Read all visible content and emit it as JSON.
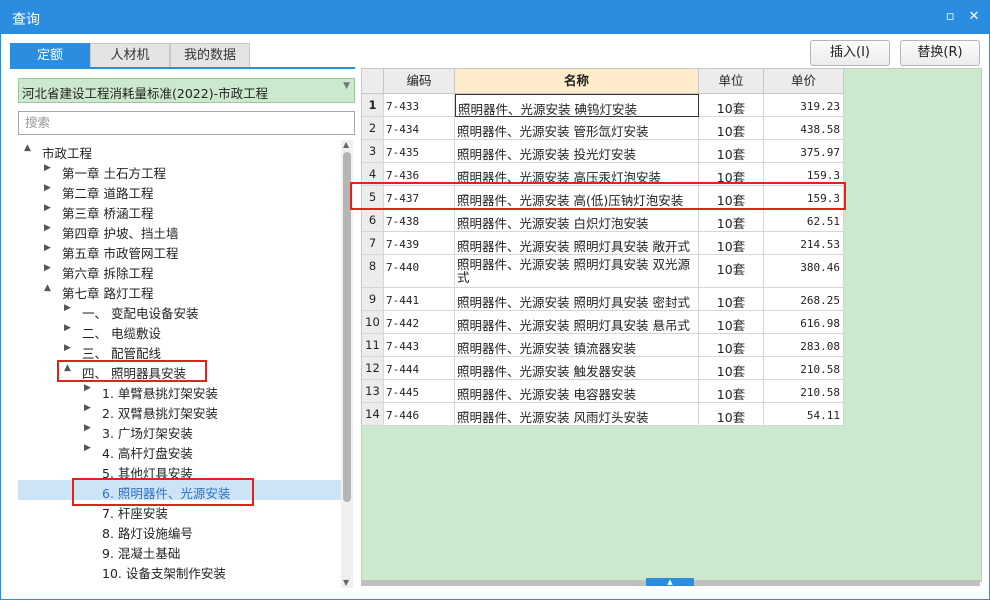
{
  "window": {
    "title": "查询",
    "maximize_icon": "maximize-icon",
    "close_icon": "close-icon"
  },
  "tabs": [
    {
      "label": "定额",
      "active": true
    },
    {
      "label": "人材机"
    },
    {
      "label": "我的数据"
    }
  ],
  "actions": {
    "insert": "插入(I)",
    "replace": "替换(R)"
  },
  "left": {
    "combo_value": "河北省建设工程消耗量标准(2022)-市政工程",
    "search_placeholder": "搜索",
    "tree": [
      {
        "label": "市政工程",
        "arrow": "▲",
        "depth": 0
      },
      {
        "label": "第一章 土石方工程",
        "arrow": "▶",
        "depth": 1
      },
      {
        "label": "第二章 道路工程",
        "arrow": "▶",
        "depth": 1
      },
      {
        "label": "第三章 桥涵工程",
        "arrow": "▶",
        "depth": 1
      },
      {
        "label": "第四章 护坡、挡土墙",
        "arrow": "▶",
        "depth": 1
      },
      {
        "label": "第五章 市政管网工程",
        "arrow": "▶",
        "depth": 1
      },
      {
        "label": "第六章 拆除工程",
        "arrow": "▶",
        "depth": 1
      },
      {
        "label": "第七章 路灯工程",
        "arrow": "▲",
        "depth": 1
      },
      {
        "label": "一、 变配电设备安装",
        "arrow": "▶",
        "depth": 2
      },
      {
        "label": "二、 电缆敷设",
        "arrow": "▶",
        "depth": 2
      },
      {
        "label": "三、 配管配线",
        "arrow": "▶",
        "depth": 2
      },
      {
        "label": "四、 照明器具安装",
        "arrow": "▲",
        "depth": 2
      },
      {
        "label": "1. 单臂悬挑灯架安装",
        "arrow": "▶",
        "depth": 3
      },
      {
        "label": "2. 双臂悬挑灯架安装",
        "arrow": "▶",
        "depth": 3
      },
      {
        "label": "3. 广场灯架安装",
        "arrow": "▶",
        "depth": 3
      },
      {
        "label": "4. 高杆灯盘安装",
        "arrow": "▶",
        "depth": 3
      },
      {
        "label": "5. 其他灯具安装",
        "arrow": "",
        "depth": 3
      },
      {
        "label": "6. 照明器件、光源安装",
        "arrow": "",
        "depth": 3,
        "selected": true
      },
      {
        "label": "7. 杆座安装",
        "arrow": "",
        "depth": 3
      },
      {
        "label": "8. 路灯设施编号",
        "arrow": "",
        "depth": 3
      },
      {
        "label": "9. 混凝土基础",
        "arrow": "",
        "depth": 3
      },
      {
        "label": "10. 设备支架制作安装",
        "arrow": "",
        "depth": 3
      }
    ]
  },
  "table": {
    "headers": {
      "code": "编码",
      "name": "名称",
      "unit": "单位",
      "price": "单价"
    },
    "rows": [
      {
        "no": "1",
        "code": "7-433",
        "name": "照明器件、光源安装 碘钨灯安装",
        "unit": "10套",
        "price": "319.23"
      },
      {
        "no": "2",
        "code": "7-434",
        "name": "照明器件、光源安装 管形氙灯安装",
        "unit": "10套",
        "price": "438.58"
      },
      {
        "no": "3",
        "code": "7-435",
        "name": "照明器件、光源安装 投光灯安装",
        "unit": "10套",
        "price": "375.97"
      },
      {
        "no": "4",
        "code": "7-436",
        "name": "照明器件、光源安装 高压汞灯泡安装",
        "unit": "10套",
        "price": "159.3"
      },
      {
        "no": "5",
        "code": "7-437",
        "name": "照明器件、光源安装 高(低)压钠灯泡安装",
        "unit": "10套",
        "price": "159.3"
      },
      {
        "no": "6",
        "code": "7-438",
        "name": "照明器件、光源安装 白炽灯泡安装",
        "unit": "10套",
        "price": "62.51"
      },
      {
        "no": "7",
        "code": "7-439",
        "name": "照明器件、光源安装 照明灯具安装 敞开式",
        "unit": "10套",
        "price": "214.53"
      },
      {
        "no": "8",
        "code": "7-440",
        "name": "照明器件、光源安装 照明灯具安装 双光源式",
        "unit": "10套",
        "price": "380.46"
      },
      {
        "no": "9",
        "code": "7-441",
        "name": "照明器件、光源安装 照明灯具安装 密封式",
        "unit": "10套",
        "price": "268.25"
      },
      {
        "no": "10",
        "code": "7-442",
        "name": "照明器件、光源安装 照明灯具安装 悬吊式",
        "unit": "10套",
        "price": "616.98"
      },
      {
        "no": "11",
        "code": "7-443",
        "name": "照明器件、光源安装 镇流器安装",
        "unit": "10套",
        "price": "283.08"
      },
      {
        "no": "12",
        "code": "7-444",
        "name": "照明器件、光源安装 触发器安装",
        "unit": "10套",
        "price": "210.58"
      },
      {
        "no": "13",
        "code": "7-445",
        "name": "照明器件、光源安装 电容器安装",
        "unit": "10套",
        "price": "210.58"
      },
      {
        "no": "14",
        "code": "7-446",
        "name": "照明器件、光源安装 风雨灯头安装",
        "unit": "10套",
        "price": "54.11"
      }
    ]
  },
  "colors": {
    "accent": "#2a8de0",
    "highlight_box": "#e2231a",
    "grid_bg": "#cde9cd",
    "header_name_bg": "#fdebc9"
  }
}
